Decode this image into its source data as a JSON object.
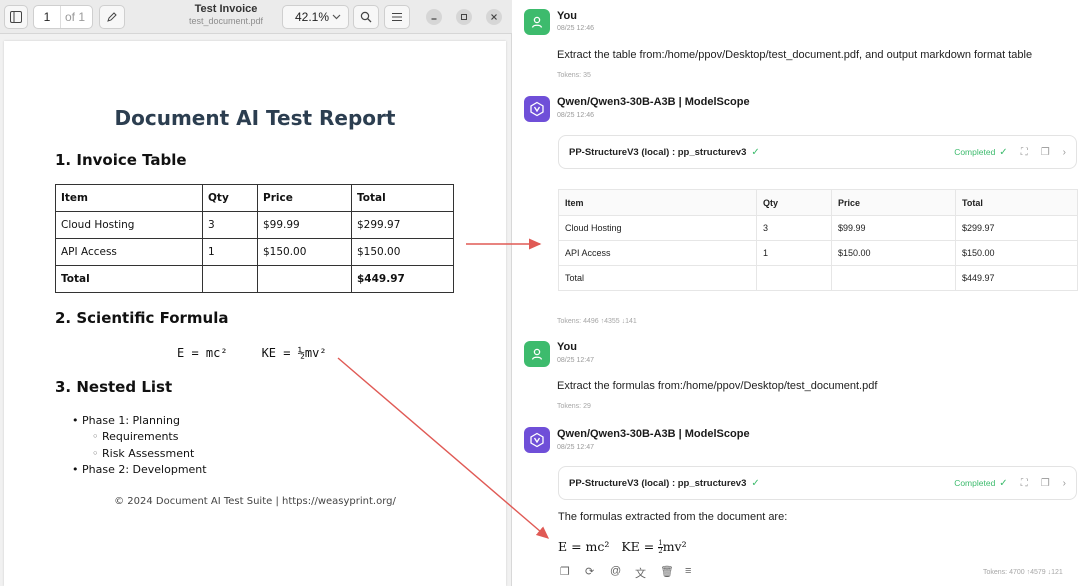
{
  "viewer": {
    "toolbar": {
      "page_current": "1",
      "page_of": "of 1",
      "doc_title": "Test Invoice",
      "doc_file": "test_document.pdf",
      "zoom": "42.1%"
    },
    "doc": {
      "title": "Document AI Test Report",
      "section1": "1. Invoice Table",
      "table_headers": [
        "Item",
        "Qty",
        "Price",
        "Total"
      ],
      "table_rows": [
        [
          "Cloud Hosting",
          "3",
          "$99.99",
          "$299.97"
        ],
        [
          "API Access",
          "1",
          "$150.00",
          "$150.00"
        ],
        [
          "Total",
          "",
          "",
          "$449.97"
        ]
      ],
      "section2": "2. Scientific Formula",
      "formula1": "E = mc²",
      "formula2": "KE = ½mv²",
      "section3": "3. Nested List",
      "list": [
        {
          "level": "top",
          "text": "Phase 1: Planning"
        },
        {
          "level": "sub",
          "text": "Requirements"
        },
        {
          "level": "sub",
          "text": "Risk Assessment"
        },
        {
          "level": "top",
          "text": "Phase 2: Development"
        }
      ],
      "footer": "© 2024 Document AI Test Suite | https://weasyprint.org/"
    }
  },
  "chat": {
    "user_name": "You",
    "bot_name": "Qwen/Qwen3-30B-A3B | ModelScope",
    "m1": {
      "time": "08/25 12:46",
      "text": "Extract the table from:/home/ppov/Desktop/test_document.pdf, and output markdown format table",
      "tokens": "Tokens: 35"
    },
    "r1": {
      "time": "08/25 12:46",
      "tool": "PP-StructureV3 (local) : pp_structurev3",
      "status": "Completed",
      "headers": [
        "Item",
        "Qty",
        "Price",
        "Total"
      ],
      "rows": [
        [
          "Cloud Hosting",
          "3",
          "$99.99",
          "$299.97"
        ],
        [
          "API Access",
          "1",
          "$150.00",
          "$150.00"
        ],
        [
          "Total",
          "",
          "",
          "$449.97"
        ]
      ],
      "tokens": "Tokens: 4496 ↑4355 ↓141"
    },
    "m2": {
      "time": "08/25 12:47",
      "text": "Extract the formulas from:/home/ppov/Desktop/test_document.pdf",
      "tokens": "Tokens: 29"
    },
    "r2": {
      "time": "08/25 12:47",
      "tool": "PP-StructureV3 (local) : pp_structurev3",
      "status": "Completed",
      "text": "The formulas extracted from the document are:",
      "formula_e": "E = mc²",
      "formula_ke_prefix": "KE = ",
      "formula_ke_suffix": "mv²",
      "frac_num": "1",
      "frac_den": "2",
      "tokens": "Tokens: 4700 ↑4579 ↓121"
    }
  },
  "colors": {
    "accent_green": "#3dbb6d",
    "bot_purple": "#6f4fd8",
    "arrow_red": "#e05a55",
    "doc_title": "#2c3e50"
  }
}
